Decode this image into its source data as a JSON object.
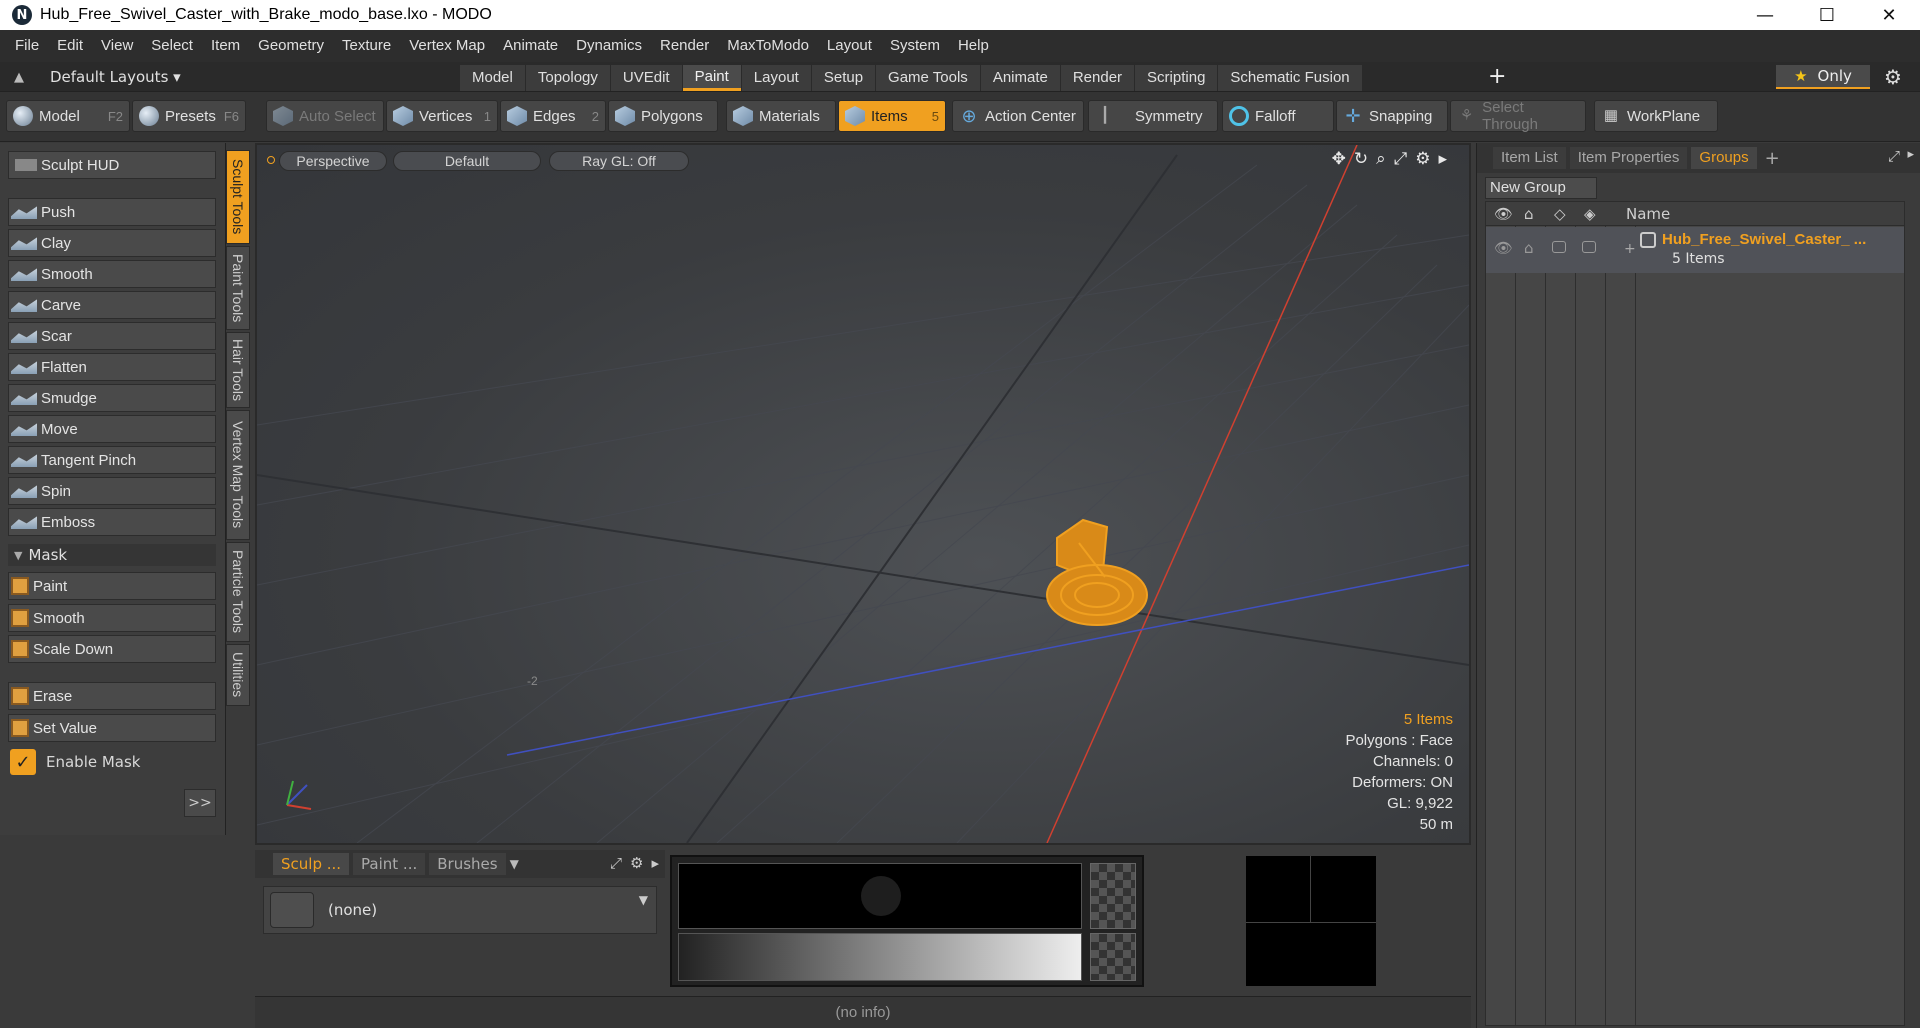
{
  "window": {
    "title": "Hub_Free_Swivel_Caster_with_Brake_modo_base.lxo - MODO",
    "minimize": "—",
    "maximize": "☐",
    "close": "✕"
  },
  "menu": [
    "File",
    "Edit",
    "View",
    "Select",
    "Item",
    "Geometry",
    "Texture",
    "Vertex Map",
    "Animate",
    "Dynamics",
    "Render",
    "MaxToModo",
    "Layout",
    "System",
    "Help"
  ],
  "layout_bar": {
    "layouts_label": "Default Layouts ▾",
    "tabs": [
      "Model",
      "Topology",
      "UVEdit",
      "Paint",
      "Layout",
      "Setup",
      "Game Tools",
      "Animate",
      "Render",
      "Scripting",
      "Schematic Fusion"
    ],
    "active_tab": "Paint",
    "only_label": "Only"
  },
  "toolbar": {
    "model": {
      "label": "Model",
      "key": "F2"
    },
    "presets": {
      "label": "Presets",
      "key": "F6"
    },
    "auto_select": "Auto Select",
    "vertices": {
      "label": "Vertices",
      "count": "1"
    },
    "edges": {
      "label": "Edges",
      "count": "2"
    },
    "polygons": "Polygons",
    "materials": "Materials",
    "items": {
      "label": "Items",
      "count": "5"
    },
    "action_center": "Action Center",
    "symmetry": "Symmetry",
    "falloff": "Falloff",
    "snapping": "Snapping",
    "select_through": "Select Through",
    "workplane": "WorkPlane"
  },
  "left_panel": {
    "sculpt_hud": "Sculpt HUD",
    "sculpt_tools": [
      "Push",
      "Clay",
      "Smooth",
      "Carve",
      "Scar",
      "Flatten",
      "Smudge",
      "Move",
      "Tangent Pinch",
      "Spin",
      "Emboss"
    ],
    "mask_header": "Mask",
    "mask_tools": [
      "Paint",
      "Smooth",
      "Scale Down"
    ],
    "extra_tools": [
      "Erase",
      "Set Value"
    ],
    "enable_mask": "Enable Mask",
    "expand_btn": ">>",
    "vertical_tabs": [
      "Sculpt Tools",
      "Paint Tools",
      "Hair Tools",
      "Vertex Map Tools",
      "Particle Tools",
      "Utilities"
    ]
  },
  "viewport": {
    "view": "Perspective",
    "shading": "Default",
    "raygl": "Ray GL: Off",
    "axis_label": "-2",
    "info": {
      "items": "5 Items",
      "polygons": "Polygons : Face",
      "channels": "Channels: 0",
      "deformers": "Deformers: ON",
      "gl": "GL: 9,922",
      "scale": "50 m"
    }
  },
  "right_panel": {
    "tabs": [
      "Item List",
      "Item Properties",
      "Groups"
    ],
    "active_tab": "Groups",
    "new_group": "New Group",
    "name_header": "Name",
    "group_name": "Hub_Free_Swivel_Caster_ ...",
    "group_count": "5 Items"
  },
  "bottom_panel": {
    "tabs": [
      "Sculp ...",
      "Paint ...",
      "Brushes"
    ],
    "brush_value": "(none)"
  },
  "status": "(no info)",
  "colors": {
    "accent": "#f0a020",
    "x_axis": "#d04030",
    "z_axis": "#4050c0",
    "mesh": "#f0a020"
  }
}
